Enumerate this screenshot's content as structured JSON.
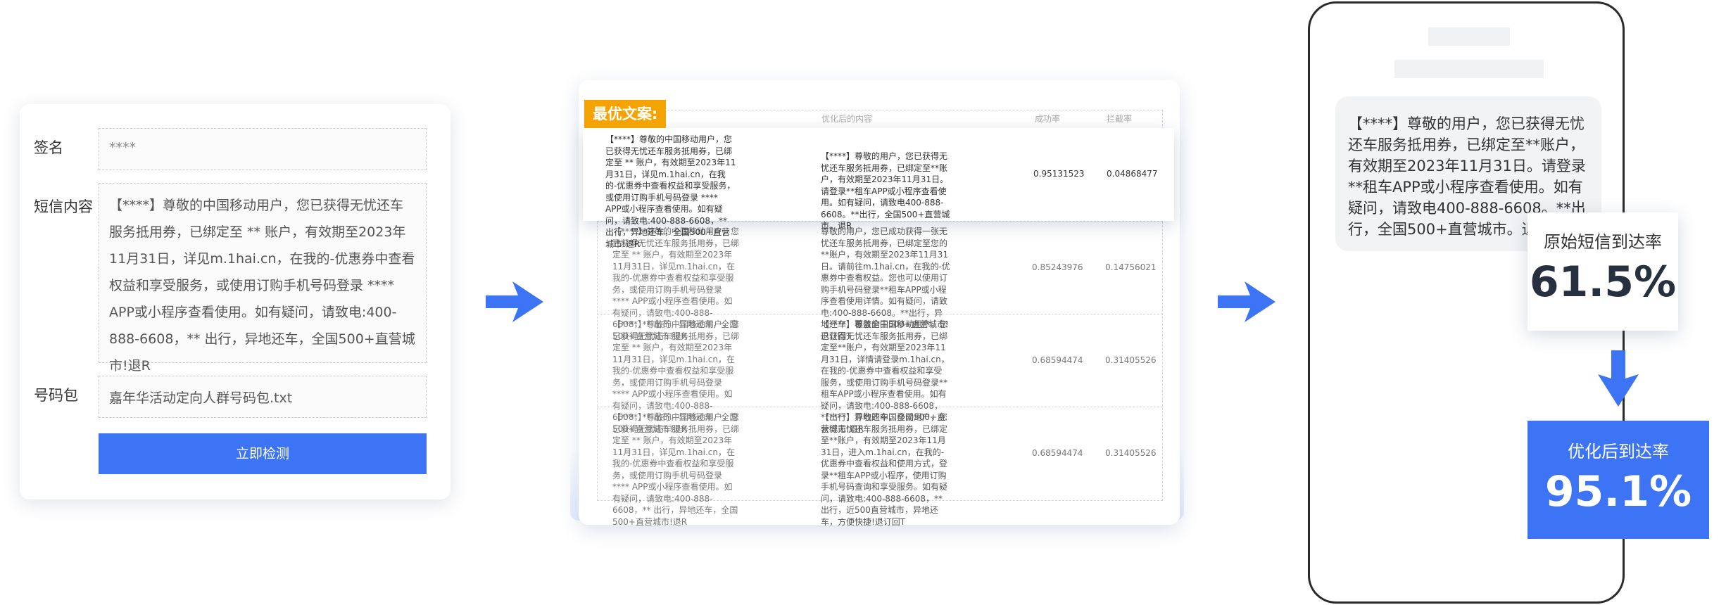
{
  "form": {
    "signature_label": "签名",
    "signature_value": "****",
    "content_label": "短信内容",
    "content_value": "【****】尊敬的中国移动用户，您已获得无忧还车服务抵用券，已绑定至 ** 账户，有效期至2023年11月31日，详见m.1hai.cn，在我的-优惠券中查看权益和享受服务，或使用订购手机号码登录 **** APP或小程序查看使用。如有疑问，请致电:400-888-6608，** 出行，异地还车，全国500+直营城市!退R",
    "package_label": "号码包",
    "package_value": "嘉年华活动定向人群号码包.txt",
    "detect_button": "立即检测"
  },
  "table": {
    "best_tag": "最优文案:",
    "headers": {
      "optimized": "优化后的内容",
      "success_rate": "成功率",
      "block_rate": "拦截率"
    },
    "rows": [
      {
        "source": "【****】尊敬的中国移动用户，您已获得无忧还车服务抵用券，已绑定至 ** 账户，有效期至2023年11月31日，详见m.1hai.cn，在我的-优惠券中查看权益和享受服务，或使用订购手机号码登录 **** APP或小程序查看使用。如有疑问，请致电:400-888-6608，** 出行，异地还车，全国500+直营城市!退R",
        "optimized": "【****】尊敬的用户，您已获得无忧还车服务抵用券，已绑定至**账户，有效期至2023年11月31日。请登录**租车APP或小程序查看使用。如有疑问，请致电400-888-6608。**出行，全国500+直营城市。退R",
        "success_rate": "0.95131523",
        "block_rate": "0.04868477"
      },
      {
        "source": "【****】尊敬的中国移动用户，您已获得无忧还车服务抵用券，已绑定至 ** 账户，有效期至2023年11月31日，详见m.1hai.cn，在我的-优惠券中查看权益和享受服务，或使用订购手机号码登录 **** APP或小程序查看使用。如有疑问，请致电:400-888-6608，** 出行，异地还车，全国500+直营城市!退R",
        "optimized": "尊敬的用户，您已成功获得一张无忧还车服务抵用券，已绑定至您的**账户，有效期至2023年11月31日。请前往m.1hai.cn，在我的-优惠券中查看权益。您也可以使用订购手机号码登录**租车APP或小程序查看使用详情。如有疑问，请致电:400-888-6608。**出行，异地还车，覆盖全国500+直营城市!退订回T",
        "success_rate": "0.85243976",
        "block_rate": "0.14756021"
      },
      {
        "source": "【****】尊敬的中国移动用户，您已获得无忧还车服务抵用券，已绑定至 ** 账户，有效期至2023年11月31日，详见m.1hai.cn，在我的-优惠券中查看权益和享受服务，或使用订购手机号码登录 **** APP或小程序查看使用。如有疑问，请致电:400-888-6608，** 出行，异地还车，全国500+直营城市!退R",
        "optimized": "【****】尊敬的中国移动用户，您已获得无忧还车服务抵用券，已绑定至**账户，有效期至2023年11月31日，详情请登录m.1hai.cn，在我的-优惠券中查看权益和享受服务，或使用订购手机号码登录**租车APP或小程序查看使用。如有疑问，请致电:400-888-6608，**出行，异地还车，全国500+直营城市!退R",
        "success_rate": "0.68594474",
        "block_rate": "0.31405526"
      },
      {
        "source": "【****】尊敬的中国移动用户，您已获得无忧还车服务抵用券，已绑定至 ** 账户，有效期至2023年11月31日，详见m.1hai.cn，在我的-优惠券中查看权益和享受服务，或使用订购手机号码登录 **** APP或小程序查看使用。如有疑问，请致电:400-888-6608，** 出行，异地还车，全国500+直营城市!退R",
        "optimized": "【****】尊敬的中国移动用户，您获得无忧还车服务抵用券，已绑定至**账户，有效期至2023年11月31日，进入m.1hai.cn，在我的-优惠券中查看权益和使用方式，登录**租车APP或小程序，使用订购手机号码查询和享受服务。如有疑问，请致电:400-888-6608，**出行，近500直营城市，异地还车，方便快捷!退订回T",
        "success_rate": "0.68594474",
        "block_rate": "0.31405526"
      }
    ]
  },
  "phone": {
    "sms_text": "【****】尊敬的用户，您已获得无忧还车服务抵用券，已绑定至**账户，有效期至2023年11月31日。请登录**租车APP或小程序查看使用。如有疑问，请致电400-888-6608。**出行，全国500+直营城市。退R"
  },
  "stats": {
    "original_label": "原始短信到达率",
    "original_value": "61.5%",
    "optimized_label": "优化后到达率",
    "optimized_value": "95.1%"
  },
  "colors": {
    "primary": "#3d74f5",
    "tag": "#f5a300"
  },
  "icons": [
    "arrow-right-icon",
    "arrow-down-icon"
  ]
}
